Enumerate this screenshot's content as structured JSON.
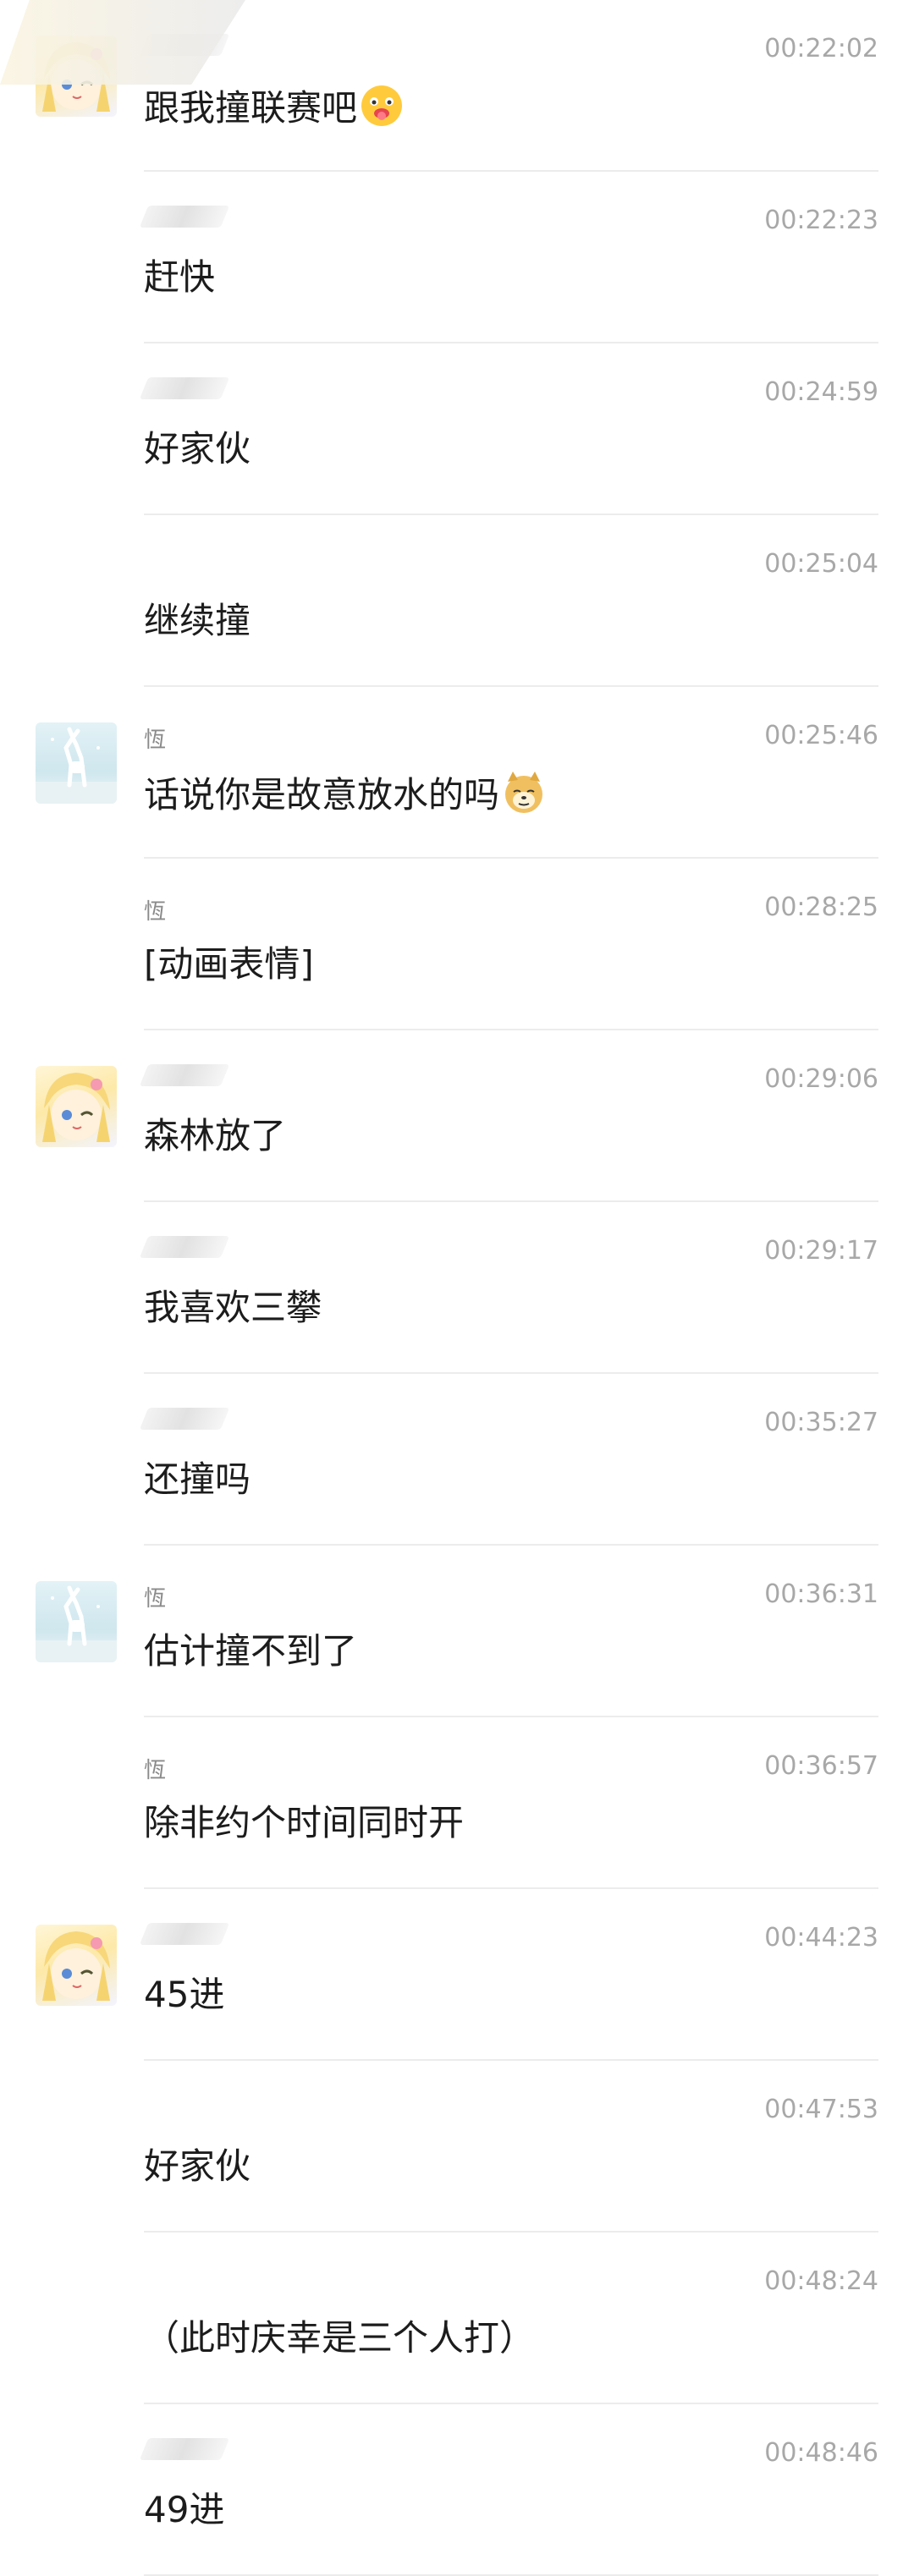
{
  "messages": [
    {
      "avatar": "girl",
      "sender": "",
      "time": "00:22:02",
      "text": "跟我撞联赛吧",
      "emoji": "face-with-tongue-icon"
    },
    {
      "avatar": "",
      "sender": "",
      "time": "00:22:23",
      "text": "赶快",
      "emoji": ""
    },
    {
      "avatar": "",
      "sender": "",
      "time": "00:24:59",
      "text": "好家伙",
      "emoji": ""
    },
    {
      "avatar": "",
      "sender": "",
      "time": "00:25:04",
      "text": "继续撞",
      "emoji": ""
    },
    {
      "avatar": "deer",
      "sender": "恆",
      "time": "00:25:46",
      "text": "话说你是故意放水的吗",
      "emoji": "doge-icon"
    },
    {
      "avatar": "",
      "sender": "恆",
      "time": "00:28:25",
      "text": "[动画表情]",
      "emoji": ""
    },
    {
      "avatar": "girl",
      "sender": "",
      "time": "00:29:06",
      "text": "森林放了",
      "emoji": ""
    },
    {
      "avatar": "",
      "sender": "",
      "time": "00:29:17",
      "text": "我喜欢三攀",
      "emoji": ""
    },
    {
      "avatar": "",
      "sender": "",
      "time": "00:35:27",
      "text": "还撞吗",
      "emoji": ""
    },
    {
      "avatar": "deer",
      "sender": "恆",
      "time": "00:36:31",
      "text": "估计撞不到了",
      "emoji": ""
    },
    {
      "avatar": "",
      "sender": "恆",
      "time": "00:36:57",
      "text": "除非约个时间同时开",
      "emoji": ""
    },
    {
      "avatar": "girl",
      "sender": "",
      "time": "00:44:23",
      "text": "45进",
      "emoji": ""
    },
    {
      "avatar": "",
      "sender": "",
      "time": "00:47:53",
      "text": "好家伙",
      "emoji": ""
    },
    {
      "avatar": "",
      "sender": "",
      "time": "00:48:24",
      "text": "（此时庆幸是三个人打）",
      "emoji": ""
    },
    {
      "avatar": "",
      "sender": "",
      "time": "00:48:46",
      "text": "49进",
      "emoji": ""
    }
  ]
}
